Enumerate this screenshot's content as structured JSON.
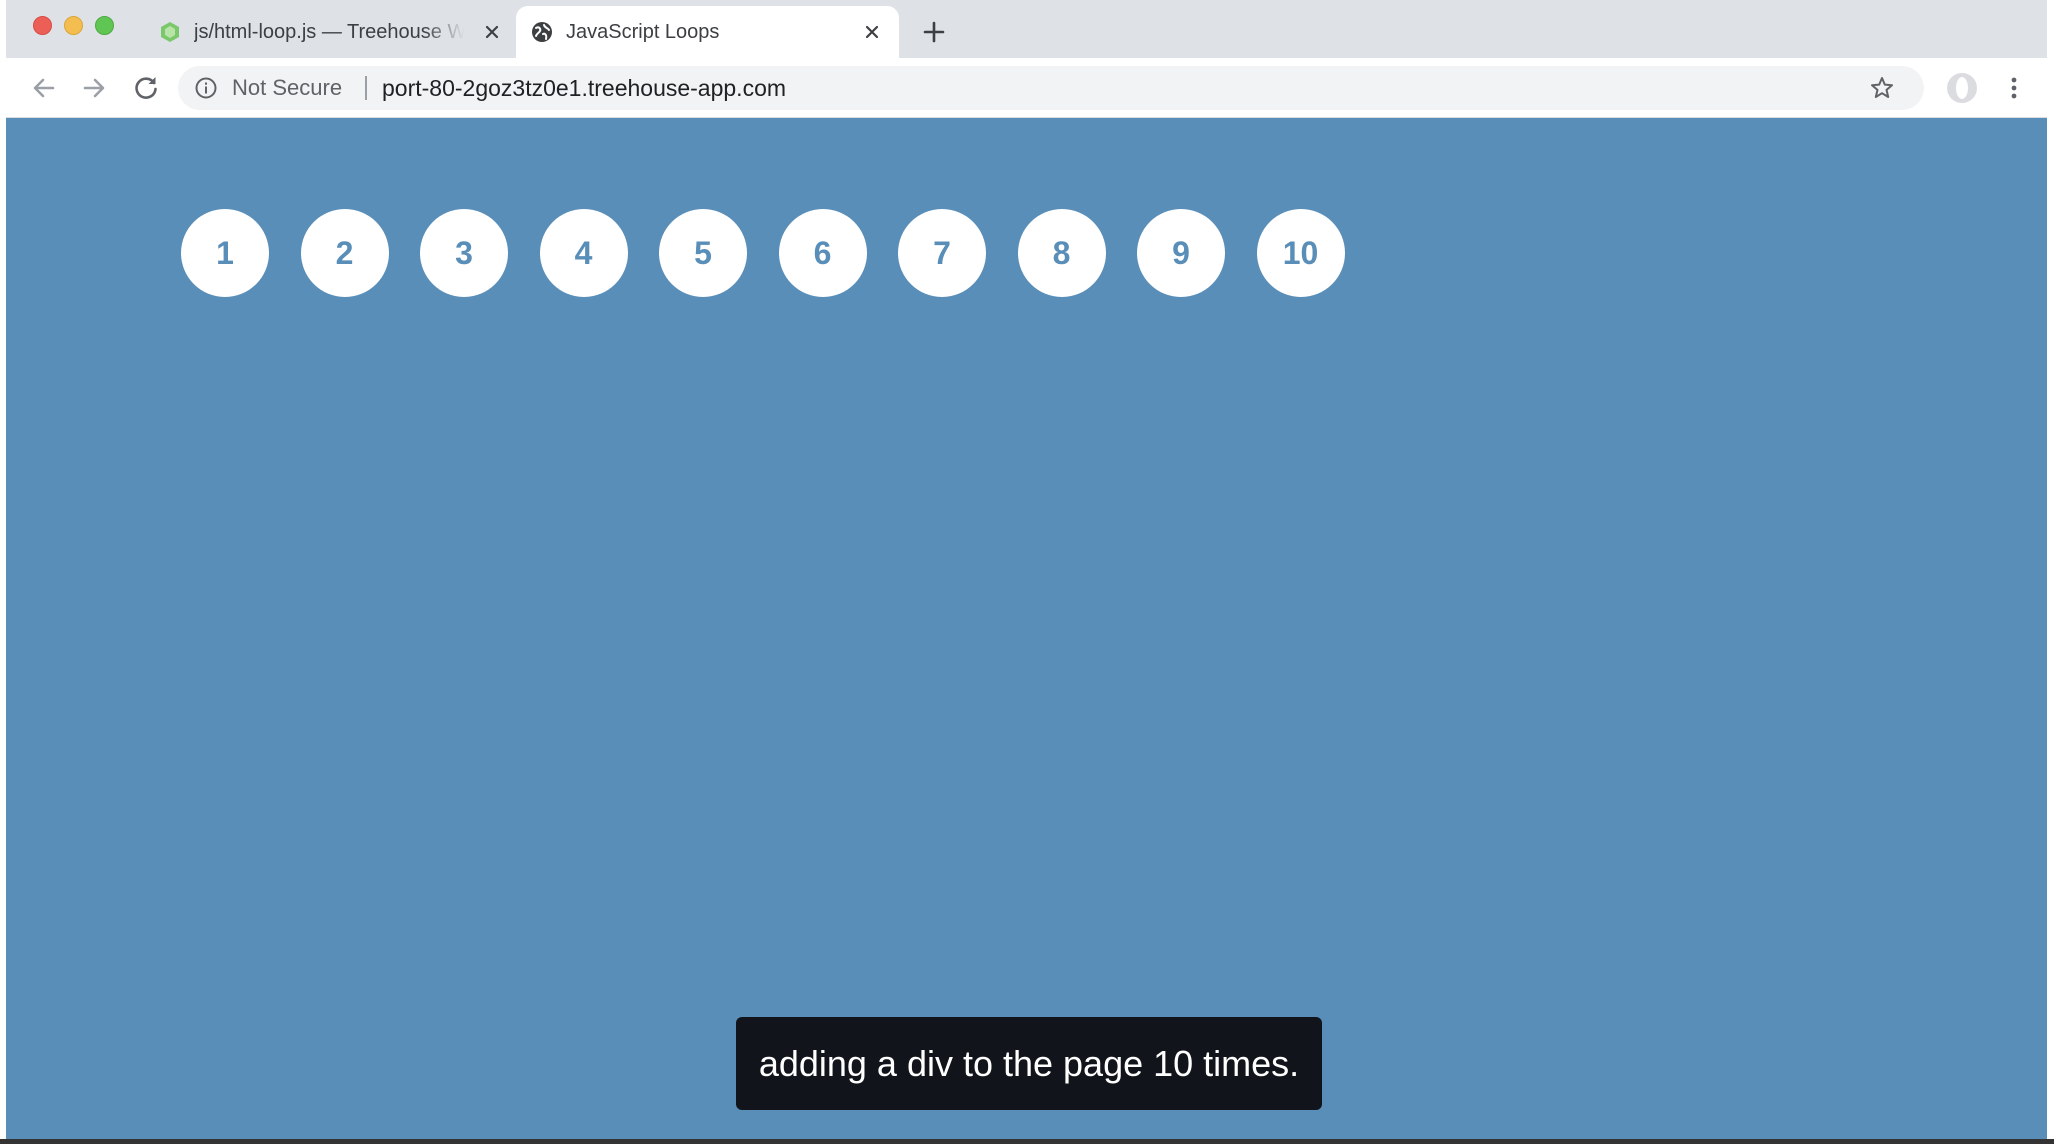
{
  "browser": {
    "tabs": [
      {
        "title": "js/html-loop.js — Treehouse W",
        "active": false,
        "favicon": "treehouse-icon"
      },
      {
        "title": "JavaScript Loops",
        "active": true,
        "favicon": "globe-icon"
      }
    ],
    "security_label": "Not Secure",
    "url": "port-80-2goz3tz0e1.treehouse-app.com"
  },
  "page": {
    "background_color": "#598eb8",
    "circles": [
      "1",
      "2",
      "3",
      "4",
      "5",
      "6",
      "7",
      "8",
      "9",
      "10"
    ]
  },
  "caption": {
    "text": "adding a div to the page 10 times."
  }
}
